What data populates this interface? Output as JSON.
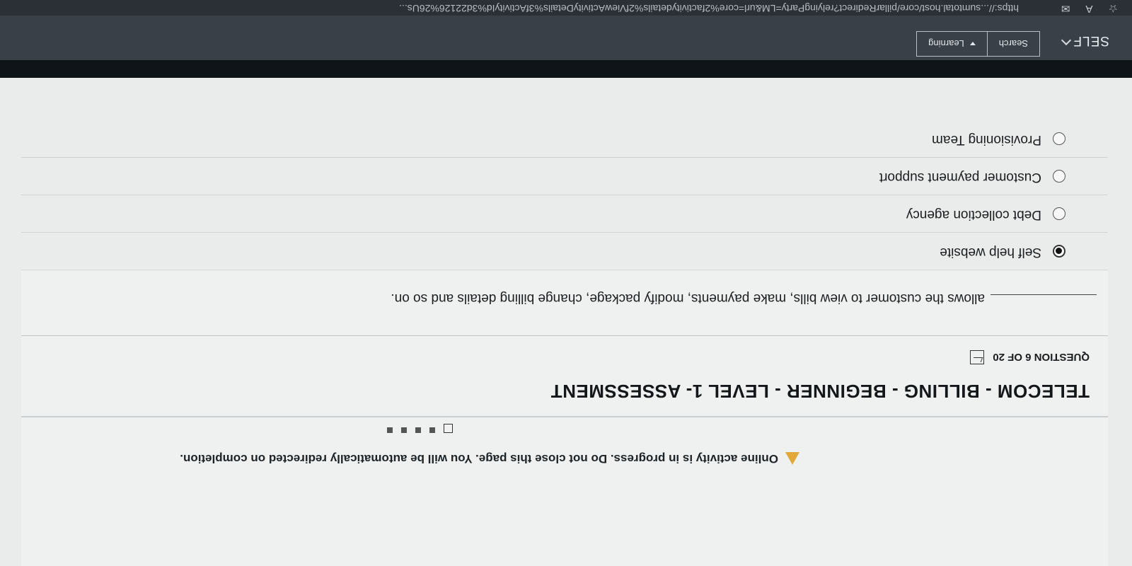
{
  "browser": {
    "url": "https://...sumtotal.host/core/pillarRedirect?relyingParty=LM&url=core%2factivitydetails%2fViewActivityDetails%3fActivityId%3d22126%26Us...",
    "icons": [
      "star-icon",
      "reader-icon",
      "mail-icon"
    ]
  },
  "header": {
    "app_name": "SELF",
    "learning_label": "Learning",
    "search_label": "Search"
  },
  "warning": {
    "text": "Online activity is in progress. Do not close this page. You will be automatically redirected on completion."
  },
  "progress": {
    "total_steps": 5,
    "current_step": 1
  },
  "assessment": {
    "title": "TELECOM - BILLING - BEGINNER - LEVEL 1- ASSESSMENT",
    "question_number": "QUESTION 6 OF 20",
    "question_text": "allows the customer to view bills, make payments, modify package, change billing details and so on.",
    "options": [
      {
        "label": "Self help website",
        "selected": true
      },
      {
        "label": "Debt collection agency",
        "selected": false
      },
      {
        "label": "Customer payment support",
        "selected": false
      },
      {
        "label": "Provisioning Team",
        "selected": false
      }
    ]
  },
  "colors": {
    "warning": "#e2a93a",
    "header": "#3a4048",
    "page": "#eef1ef"
  }
}
